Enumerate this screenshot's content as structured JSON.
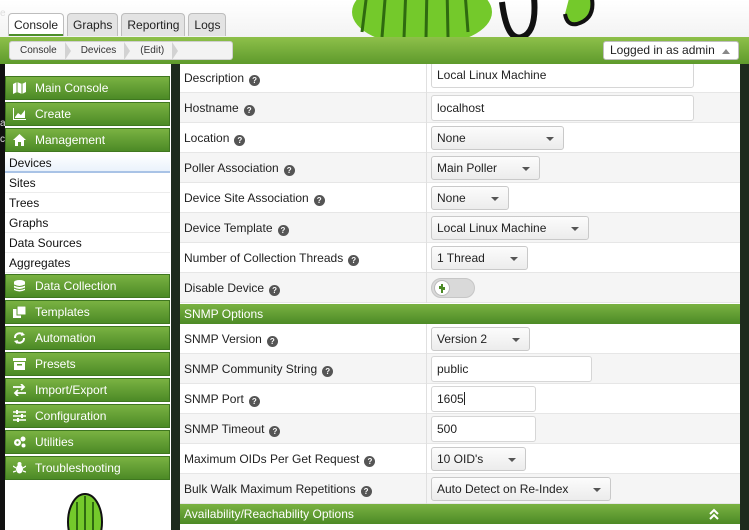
{
  "tabs": [
    {
      "label": "Console",
      "active": true
    },
    {
      "label": "Graphs",
      "active": false
    },
    {
      "label": "Reporting",
      "active": false
    },
    {
      "label": "Logs",
      "active": false
    }
  ],
  "breadcrumb": [
    "Console",
    "Devices",
    "(Edit)"
  ],
  "user_menu": "Logged in as admin",
  "edge_glyphs": [
    "e",
    "a",
    "c"
  ],
  "sidebar": {
    "top_items": [
      {
        "label": "Main Console",
        "icon": "map-icon"
      },
      {
        "label": "Create",
        "icon": "chart-icon"
      },
      {
        "label": "Management",
        "icon": "home-icon"
      }
    ],
    "sub_items": [
      "Devices",
      "Sites",
      "Trees",
      "Graphs",
      "Data Sources",
      "Aggregates"
    ],
    "selected_sub": "Devices",
    "bottom_items": [
      {
        "label": "Data Collection",
        "icon": "database-icon"
      },
      {
        "label": "Templates",
        "icon": "copy-icon"
      },
      {
        "label": "Automation",
        "icon": "refresh-icon"
      },
      {
        "label": "Presets",
        "icon": "archive-icon"
      },
      {
        "label": "Import/Export",
        "icon": "exchange-icon"
      },
      {
        "label": "Configuration",
        "icon": "sliders-icon"
      },
      {
        "label": "Utilities",
        "icon": "gears-icon"
      },
      {
        "label": "Troubleshooting",
        "icon": "bug-icon"
      }
    ]
  },
  "form": {
    "general": [
      {
        "label": "Description",
        "type": "text",
        "value": "Local Linux Machine"
      },
      {
        "label": "Hostname",
        "type": "text",
        "value": "localhost"
      },
      {
        "label": "Location",
        "type": "select",
        "value": "None"
      },
      {
        "label": "Poller Association",
        "type": "select",
        "value": "Main Poller"
      },
      {
        "label": "Device Site Association",
        "type": "select",
        "value": "None"
      },
      {
        "label": "Device Template",
        "type": "select",
        "value": "Local Linux Machine"
      },
      {
        "label": "Number of Collection Threads",
        "type": "select",
        "value": "1 Thread"
      },
      {
        "label": "Disable Device",
        "type": "toggle",
        "value": "off"
      }
    ],
    "snmp_section_title": "SNMP Options",
    "snmp": [
      {
        "label": "SNMP Version",
        "type": "select",
        "value": "Version 2"
      },
      {
        "label": "SNMP Community String",
        "type": "text",
        "value": "public"
      },
      {
        "label": "SNMP Port",
        "type": "text",
        "value": "1605"
      },
      {
        "label": "SNMP Timeout",
        "type": "text",
        "value": "500"
      },
      {
        "label": "Maximum OIDs Per Get Request",
        "type": "select",
        "value": "10 OID's"
      },
      {
        "label": "Bulk Walk Maximum Repetitions",
        "type": "select",
        "value": "Auto Detect on Re-Index"
      }
    ],
    "avail_section_title": "Availability/Reachability Options"
  },
  "colors": {
    "accent_green": "#5e9a2c",
    "header_white": "#ffffff"
  }
}
